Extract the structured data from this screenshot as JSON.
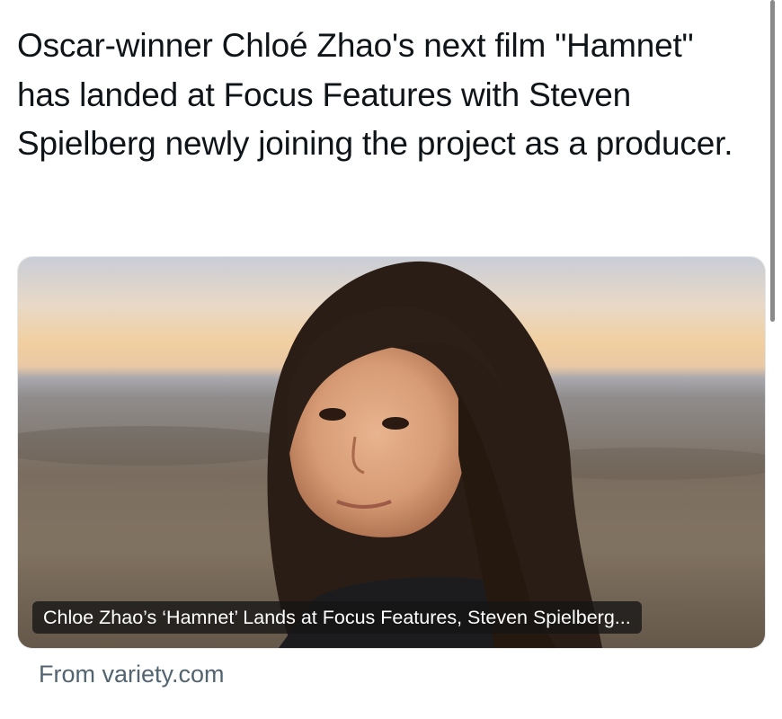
{
  "tweet": {
    "text": "Oscar-winner Chloé Zhao's next film \"Hamnet\" has landed at Focus Features with Steven Spielberg newly joining the project as a producer."
  },
  "card": {
    "title": "Chloe Zhao’s ‘Hamnet’ Lands at Focus Features, Steven Spielberg...",
    "image_description": "portrait of a woman with long dark hair in front of a desert landscape at dusk"
  },
  "source": {
    "label": "From variety.com"
  },
  "colors": {
    "text": "#0f1419",
    "secondary_text": "#536471",
    "card_border": "#e3e6e8"
  }
}
